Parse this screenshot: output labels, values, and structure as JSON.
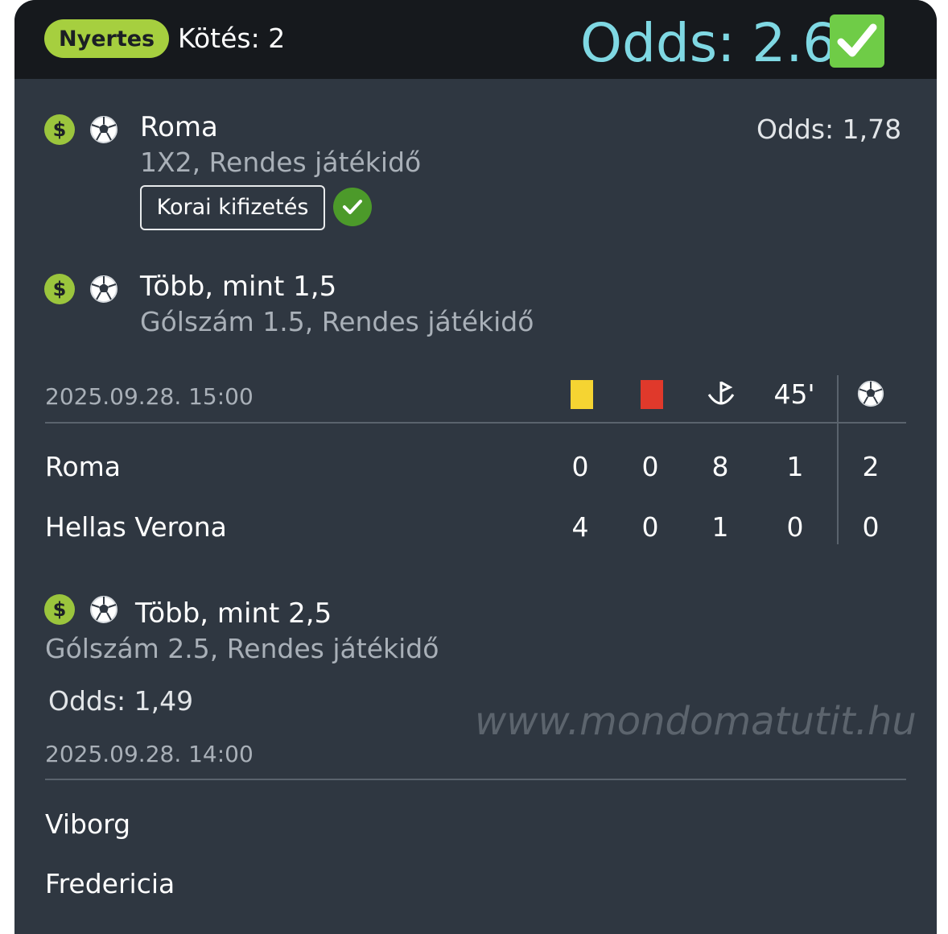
{
  "header": {
    "status_badge": "Nyertes",
    "bet_count": "Kötés: 2",
    "total_odds": "Odds: 2.65"
  },
  "selections": [
    {
      "title": "Roma",
      "market": "1X2, Rendes játékidő",
      "odds": "Odds: 1,78",
      "early_payout": "Korai kifizetés"
    },
    {
      "title": "Több, mint 1,5",
      "market": "Gólszám 1.5, Rendes játékidő"
    },
    {
      "title": "Több, mint 2,5",
      "market": "Gólszám 2.5, Rendes játékidő",
      "odds": "Odds: 1,49"
    }
  ],
  "match1": {
    "datetime": "2025.09.28.  15:00",
    "half_time_label": "45'",
    "teams": [
      {
        "name": "Roma",
        "yellow": "0",
        "red": "0",
        "corners": "8",
        "ht": "1",
        "goals": "2"
      },
      {
        "name": "Hellas Verona",
        "yellow": "4",
        "red": "0",
        "corners": "1",
        "ht": "0",
        "goals": "0"
      }
    ]
  },
  "match2": {
    "datetime": "2025.09.28.  14:00",
    "teams": [
      {
        "name": "Viborg"
      },
      {
        "name": "Fredericia"
      }
    ]
  },
  "watermark": "www.mondomatutit.hu",
  "colors": {
    "card_bg": "#2f3741",
    "header_bg": "#16191d",
    "badge_green": "#a6cf3f",
    "total_odds": "#7fd8e3",
    "yellow_card": "#f5d432",
    "red_card": "#e0392b",
    "success_green": "#4c9a2a"
  },
  "icons": [
    "dollar-icon",
    "soccer-ball-icon",
    "check-icon",
    "yellow-card-icon",
    "red-card-icon",
    "corner-flag-icon"
  ]
}
